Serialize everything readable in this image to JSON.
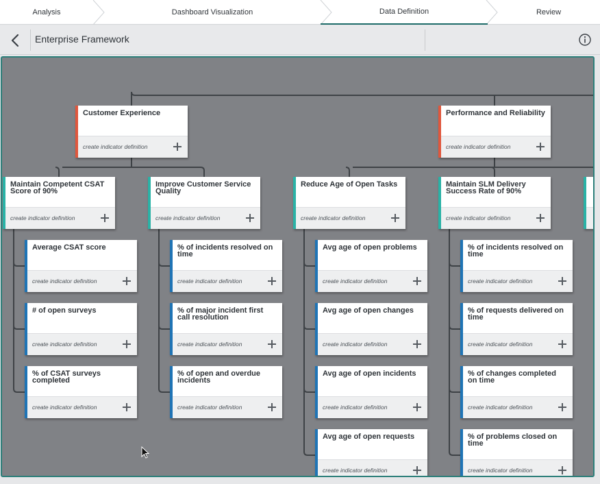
{
  "stepper": {
    "steps": [
      "Analysis",
      "Dashboard Visualization",
      "Data Definition",
      "Review"
    ],
    "active_step": "Data Definition"
  },
  "header": {
    "title": "Enterprise Framework",
    "back_icon": "chevron-left-icon",
    "info_icon": "info-icon"
  },
  "colors": {
    "objective_accent": "#e0573d",
    "goal_accent": "#2ab2a6",
    "indicator_accent": "#1f74b5",
    "active_step_underline": "#1d6b68",
    "canvas_border": "#2c7f7a"
  },
  "framework": {
    "action_label": "create indicator definition",
    "objectives": [
      {
        "title": "Customer Experience",
        "goals": [
          {
            "title": "Maintain Competent CSAT Score of 90%",
            "indicators": [
              "Average CSAT score",
              "# of open surveys",
              "% of CSAT surveys completed"
            ]
          },
          {
            "title": "Improve Customer Service Quality",
            "indicators": [
              "% of incidents resolved on time",
              "% of major incident first call resolution",
              "% of open and overdue incidents"
            ]
          }
        ]
      },
      {
        "title": "Performance and Reliability",
        "goals": [
          {
            "title": "Reduce Age of Open Tasks",
            "indicators": [
              "Avg age of open problems",
              "Avg age of open changes",
              "Avg age of open incidents",
              "Avg age of open requests"
            ]
          },
          {
            "title": "Maintain SLM Delivery Success Rate of 90%",
            "indicators": [
              "% of incidents resolved on time",
              "% of requests delivered on time",
              "% of changes completed on time",
              "% of problems closed on time"
            ]
          }
        ]
      }
    ]
  }
}
